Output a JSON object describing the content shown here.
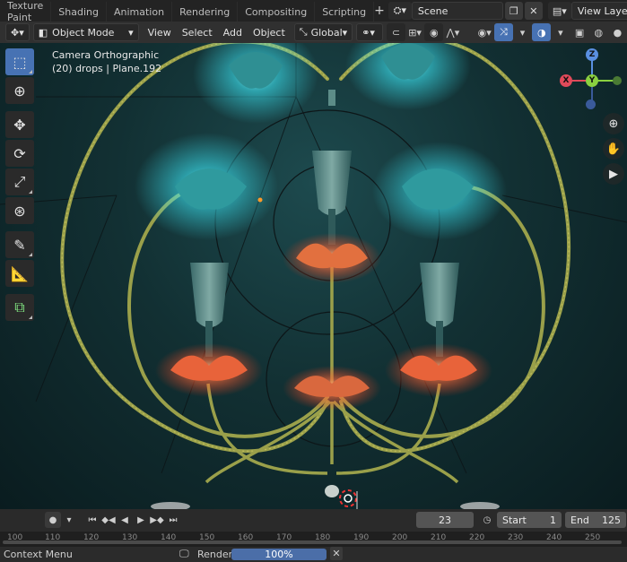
{
  "workspace_tabs": [
    "Texture Paint",
    "Shading",
    "Animation",
    "Rendering",
    "Compositing",
    "Scripting"
  ],
  "add_workspace": "+",
  "scene": {
    "label": "Scene"
  },
  "view_layer": {
    "label": "View Layer"
  },
  "header": {
    "mode": "Object Mode",
    "menus": [
      "View",
      "Select",
      "Add",
      "Object"
    ],
    "transform_orientation": "Global"
  },
  "viewport": {
    "camera_title": "Camera Orthographic",
    "object_info": "(20) drops | Plane.192"
  },
  "gizmo": {
    "z": "Z",
    "x": "X",
    "y": "Y"
  },
  "timeline": {
    "current_frame": "23",
    "start_label": "Start",
    "start_value": "1",
    "end_label": "End",
    "end_value": "125"
  },
  "ruler_ticks": [
    "100",
    "110",
    "120",
    "130",
    "140",
    "150",
    "160",
    "170",
    "180",
    "190",
    "200",
    "210",
    "220",
    "230",
    "240",
    "250"
  ],
  "statusbar": {
    "context_menu": "Context Menu",
    "render_label": "Render",
    "progress_text": "100%",
    "progress_value": 1.0
  },
  "colors": {
    "accent": "#4772b3",
    "teal_glow": "#3ef0ff",
    "orange_glow": "#ff6a3a",
    "stem": "#9aa04a"
  }
}
